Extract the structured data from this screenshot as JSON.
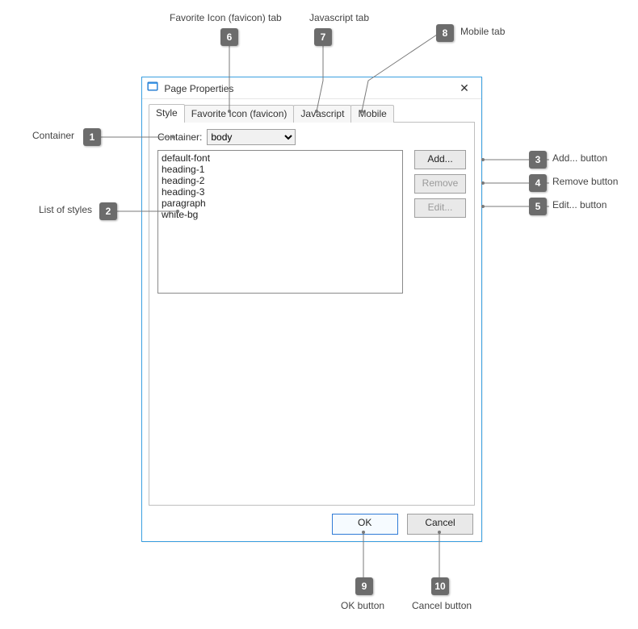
{
  "dialog": {
    "title": "Page Properties",
    "close_icon": "✕"
  },
  "tabs": {
    "style": "Style",
    "favicon": "Favorite Icon (favicon)",
    "javascript": "Javascript",
    "mobile": "Mobile"
  },
  "styleTab": {
    "container_label": "Container:",
    "container_value": "body",
    "styles": [
      "default-font",
      "heading-1",
      "heading-2",
      "heading-3",
      "paragraph",
      "white-bg"
    ],
    "buttons": {
      "add": "Add...",
      "remove": "Remove",
      "edit": "Edit..."
    }
  },
  "footer": {
    "ok": "OK",
    "cancel": "Cancel"
  },
  "callouts": {
    "c1": {
      "n": "1",
      "label": "Container"
    },
    "c2": {
      "n": "2",
      "label": "List of styles"
    },
    "c3": {
      "n": "3",
      "label": "Add... button"
    },
    "c4": {
      "n": "4",
      "label": "Remove button"
    },
    "c5": {
      "n": "5",
      "label": "Edit... button"
    },
    "c6": {
      "n": "6",
      "label": "Favorite Icon (favicon) tab"
    },
    "c7": {
      "n": "7",
      "label": "Javascript tab"
    },
    "c8": {
      "n": "8",
      "label": "Mobile tab"
    },
    "c9": {
      "n": "9",
      "label": "OK button"
    },
    "c10": {
      "n": "10",
      "label": "Cancel button"
    }
  }
}
